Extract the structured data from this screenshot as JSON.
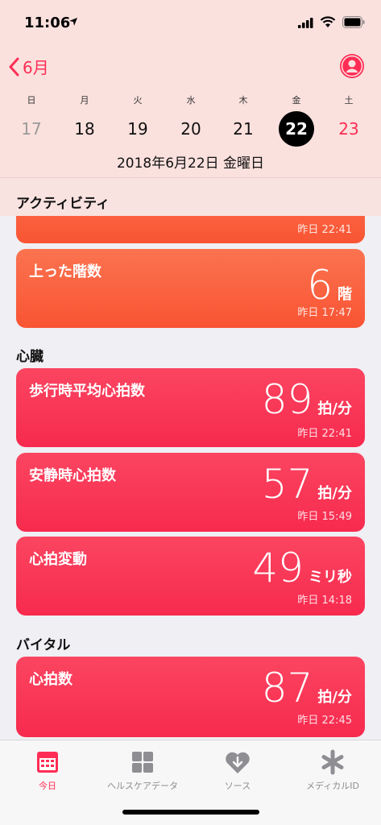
{
  "status_bar": {
    "time": "11:06"
  },
  "nav": {
    "back_label": "6月"
  },
  "calendar": {
    "weekdays": [
      "日",
      "月",
      "火",
      "水",
      "木",
      "金",
      "土"
    ],
    "days": [
      "17",
      "18",
      "19",
      "20",
      "21",
      "22",
      "23"
    ],
    "selected_index": 5,
    "full_date": "2018年6月22日 金曜日"
  },
  "sections": {
    "activity": "アクティビティ",
    "heart": "心臓",
    "vitals": "バイタル"
  },
  "cards": {
    "partial": {
      "time": "昨日 22:41"
    },
    "floors": {
      "title": "上った階数",
      "value": "6",
      "unit": "階",
      "time": "昨日 17:47"
    },
    "walking_hr": {
      "title": "歩行時平均心拍数",
      "value": "89",
      "unit": "拍/分",
      "time": "昨日 22:41"
    },
    "resting_hr": {
      "title": "安静時心拍数",
      "value": "57",
      "unit": "拍/分",
      "time": "昨日 15:49"
    },
    "hrv": {
      "title": "心拍変動",
      "value": "49",
      "unit": "ミリ秒",
      "time": "昨日 14:18"
    },
    "heart_rate": {
      "title": "心拍数",
      "value": "87",
      "unit": "拍/分",
      "time": "昨日 22:45"
    }
  },
  "tabs": [
    {
      "label": "今日",
      "icon": "calendar-icon",
      "active": true
    },
    {
      "label": "ヘルスケアデータ",
      "icon": "grid-icon",
      "active": false
    },
    {
      "label": "ソース",
      "icon": "heart-download-icon",
      "active": false
    },
    {
      "label": "メディカルID",
      "icon": "asterisk-icon",
      "active": false
    }
  ],
  "colors": {
    "accent": "#ff2d55",
    "activity_card": "#f95433",
    "heart_card": "#f72a4e"
  }
}
